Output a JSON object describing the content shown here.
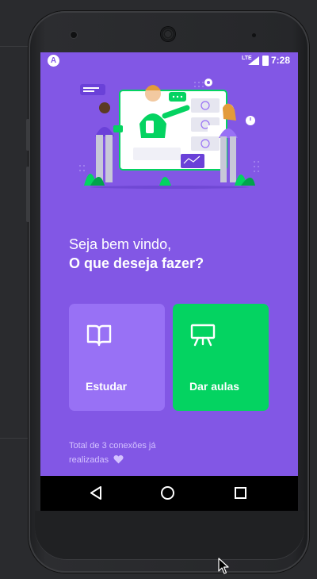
{
  "status_bar": {
    "app_icon": "proffy-logo-icon",
    "network": "LTE",
    "time": "7:28"
  },
  "main": {
    "greeting_line1": "Seja bem vindo,",
    "greeting_line2": "O que deseja fazer?",
    "buttons": [
      {
        "label": "Estudar",
        "icon": "book-open-icon",
        "color": "#9871f5"
      },
      {
        "label": "Dar aulas",
        "icon": "presentation-board-icon",
        "color": "#04d361"
      }
    ],
    "connections_line1": "Total de 3 conexões já",
    "connections_line2": "realizadas",
    "connections_icon": "heart-icon"
  },
  "colors": {
    "primary": "#8257e5",
    "secondary": "#04d361",
    "primary_lighter": "#9871f5"
  },
  "navbar": {
    "back_icon": "back-triangle-icon",
    "home_icon": "home-circle-icon",
    "recents_icon": "recents-square-icon"
  }
}
